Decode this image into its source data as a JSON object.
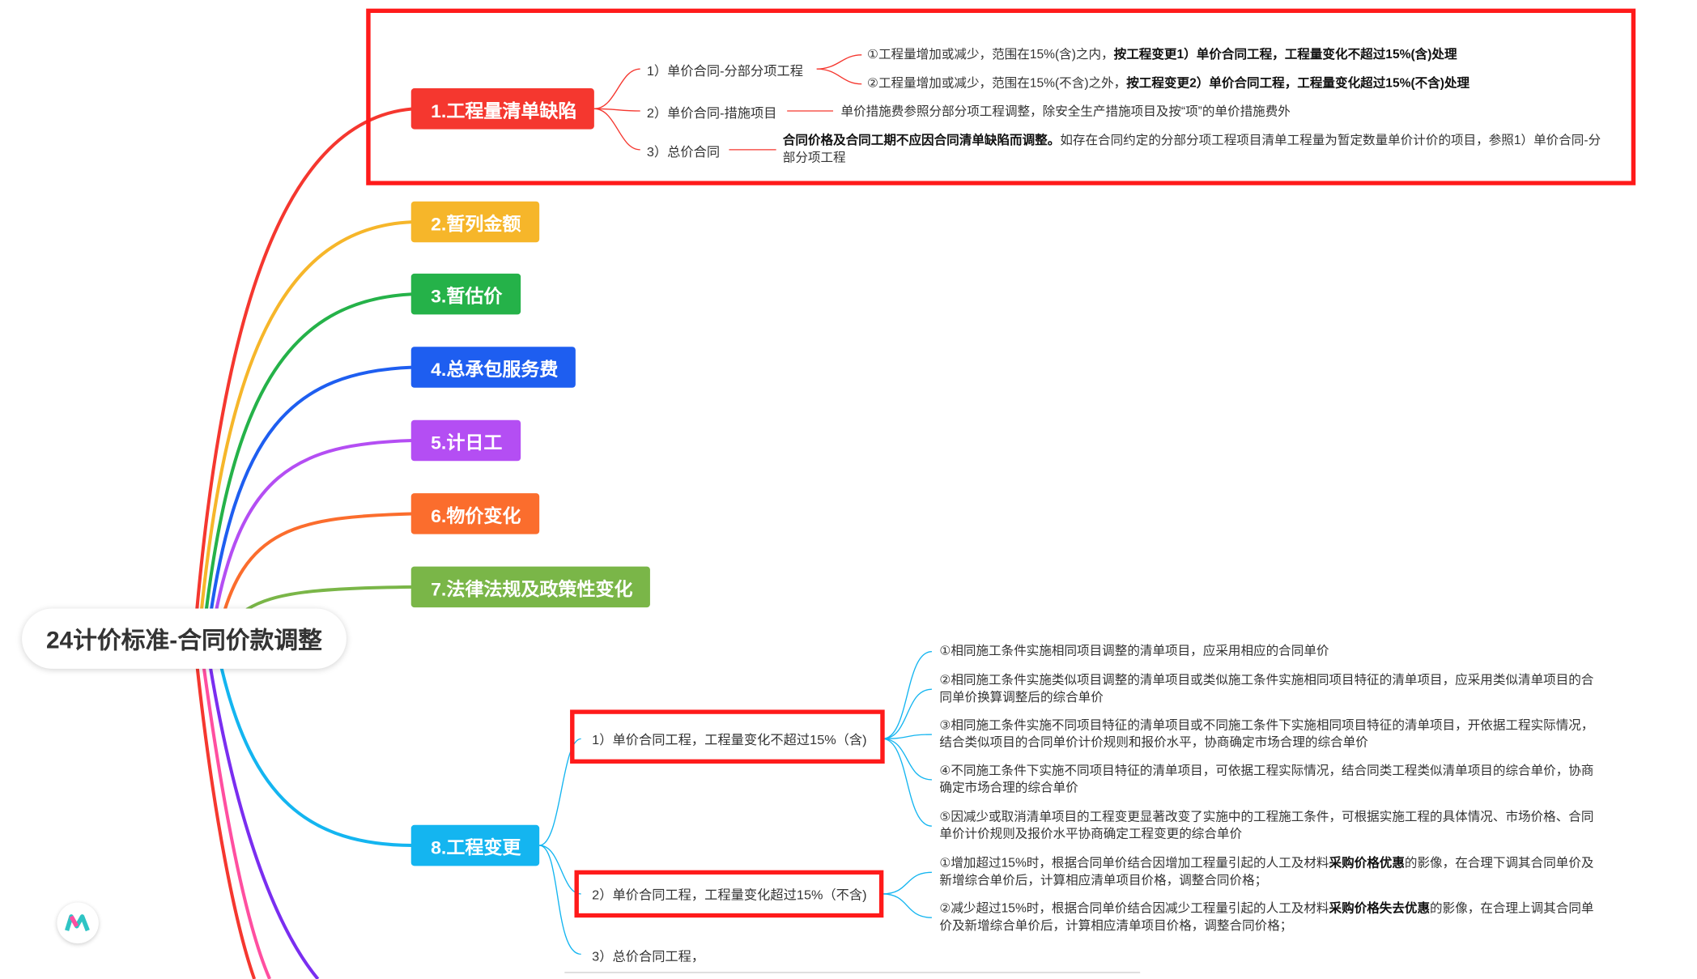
{
  "root": {
    "title": "24计价标准-合同价款调整"
  },
  "topics": [
    {
      "label": "1.工程量清单缺陷",
      "color": "#f5372f"
    },
    {
      "label": "2.暂列金额",
      "color": "#f6b62a"
    },
    {
      "label": "3.暂估价",
      "color": "#25b249"
    },
    {
      "label": "4.总承包服务费",
      "color": "#1e5ef0"
    },
    {
      "label": "5.计日工",
      "color": "#b44ef3"
    },
    {
      "label": "6.物价变化",
      "color": "#fb6d2d"
    },
    {
      "label": "7.法律法规及政策性变化",
      "color": "#7ab648"
    },
    {
      "label": "8.工程变更",
      "color": "#14b5f0"
    }
  ],
  "defects": {
    "b1": {
      "label": "1）单价合同-分部分项工程",
      "leaf1_a": "①工程量增加或减少，范围在15%(含)之内，",
      "leaf1_b": "按工程变更1）单价合同工程，工程量变化不超过15%(含)处理",
      "leaf2_a": "②工程量增加或减少，范围在15%(不含)之外，",
      "leaf2_b": "按工程变更2）单价合同工程，工程量变化超过15%(不含)处理"
    },
    "b2": {
      "label": "2）单价合同-措施项目",
      "leaf": "单价措施费参照分部分项工程调整，除安全生产措施项目及按“项”的单价措施费外"
    },
    "b3": {
      "label": "3）总价合同",
      "leaf_bold": "合同价格及合同工期不应因合同清单缺陷而调整。",
      "leaf_rest": "如存在合同约定的分部分项工程项目清单工程量为暂定数量单价计价的项目，参照1）单价合同-分部分项工程"
    }
  },
  "change": {
    "b1": {
      "label": "1）单价合同工程，工程量变化不超过15%（含)",
      "leaves": [
        "①相同施工条件实施相同项目调整的清单项目，应采用相应的合同单价",
        "②相同施工条件实施类似项目调整的清单项目或类似施工条件实施相同项目特征的清单项目，应采用类似清单项目的合同单价换算调整后的综合单价",
        "③相同施工条件实施不同项目特征的清单项目或不同施工条件下实施相同项目特征的清单项目，开依据工程实际情况，结合类似项目的合同单价计价规则和报价水平，协商确定市场合理的综合单价",
        "④不同施工条件下实施不同项目特征的清单项目，可依据工程实际情况，结合同类工程类似清单项目的综合单价，协商确定市场合理的综合单价",
        "⑤因减少或取消清单项目的工程变更显著改变了实施中的工程施工条件，可根据实施工程的具体情况、市场价格、合同单价计价规则及报价水平协商确定工程变更的综合单价"
      ]
    },
    "b2": {
      "label": "2）单价合同工程，工程量变化超过15%（不含)",
      "leaf1_a": "①增加超过15%时，根据合同单价结合因增加工程量引起的人工及材料",
      "leaf1_b": "采购价格优惠",
      "leaf1_c": "的影像，在合理下调其合同单价及新增综合单价后，计算相应清单项目价格，调整合同价格；",
      "leaf2_a": "②减少超过15%时，根据合同单价结合因减少工程量引起的人工及材料",
      "leaf2_b": "采购价格失去优惠",
      "leaf2_c": "的影像，在合理上调其合同单价及新增综合单价后，计算相应清单项目价格，调整合同价格；"
    },
    "b3": {
      "label": "3）总价合同工程，"
    }
  },
  "colors": {
    "highlight": "#ff1a1a",
    "text": "#333333"
  },
  "logo": {
    "icon": "mindmap-logo-icon"
  }
}
